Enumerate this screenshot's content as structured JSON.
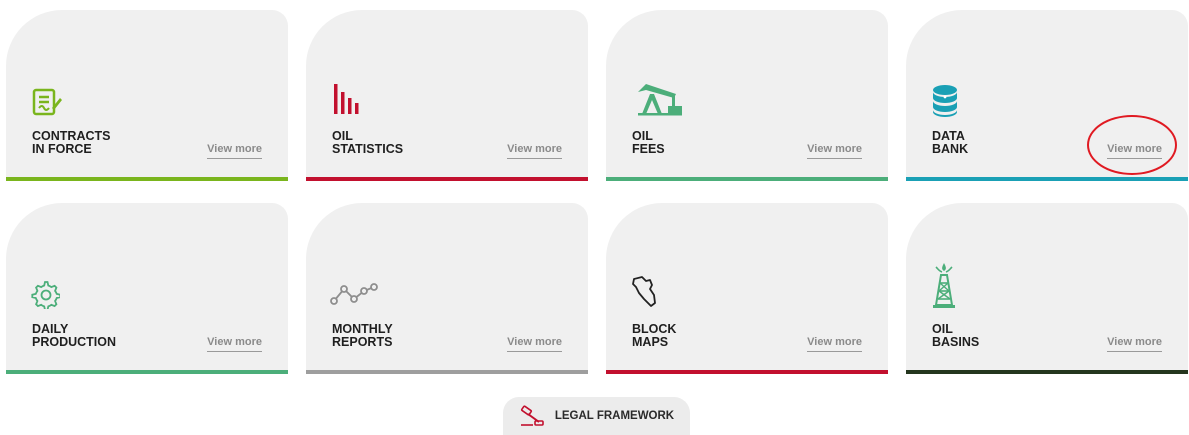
{
  "cards": [
    {
      "title_line1": "CONTRACTS",
      "title_line2": "IN FORCE",
      "link": "View more",
      "icon": "contract-icon",
      "bar_color": "#7ab51d"
    },
    {
      "title_line1": "OIL",
      "title_line2": "STATISTICS",
      "link": "View more",
      "icon": "bar-chart-icon",
      "bar_color": "#c2102e"
    },
    {
      "title_line1": "OIL",
      "title_line2": "FEES",
      "link": "View more",
      "icon": "pumpjack-icon",
      "bar_color": "#4cae7a"
    },
    {
      "title_line1": "DATA",
      "title_line2": "BANK",
      "link": "View more",
      "icon": "database-icon",
      "bar_color": "#1aa0b5"
    },
    {
      "title_line1": "DAILY",
      "title_line2": "PRODUCTION",
      "link": "View more",
      "icon": "gear-icon",
      "bar_color": "#4cae7a"
    },
    {
      "title_line1": "MONTHLY",
      "title_line2": "REPORTS",
      "link": "View more",
      "icon": "line-chart-icon",
      "bar_color": "#9e9e9e"
    },
    {
      "title_line1": "BLOCK",
      "title_line2": "MAPS",
      "link": "View more",
      "icon": "map-icon",
      "bar_color": "#c2102e"
    },
    {
      "title_line1": "OIL",
      "title_line2": "BASINS",
      "link": "View more",
      "icon": "oil-rig-icon",
      "bar_color": "#24361e"
    }
  ],
  "legal": {
    "label": "LEGAL FRAMEWORK",
    "icon": "gavel-icon"
  },
  "colors": {
    "green": "#7ab51d",
    "red": "#c2102e",
    "teal_green": "#4cae7a",
    "blue": "#1aa0b5",
    "gray": "#9e9e9e",
    "dark": "#24361e",
    "highlight": "#e01a22"
  }
}
